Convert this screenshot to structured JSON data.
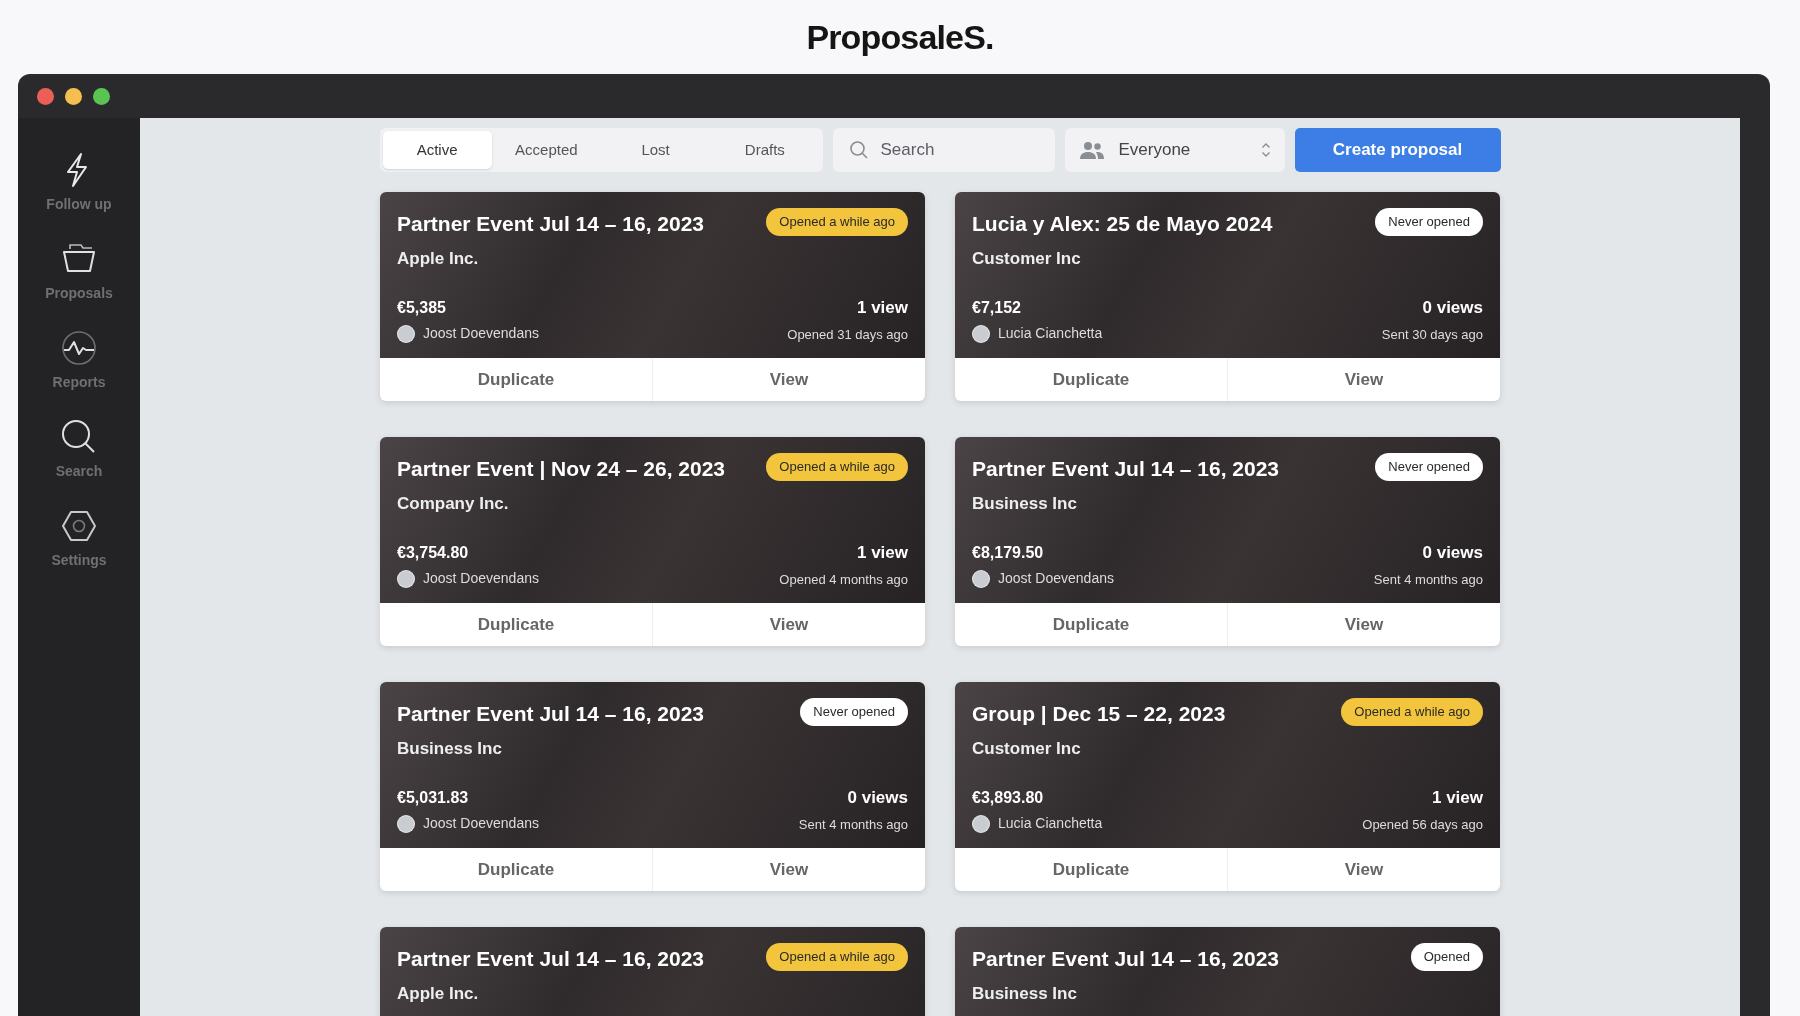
{
  "brand": "ProposaleS.",
  "sidebar": {
    "items": [
      {
        "label": "Follow up",
        "selected": false
      },
      {
        "label": "Proposals",
        "selected": false
      },
      {
        "label": "Reports",
        "selected": false
      },
      {
        "label": "Search",
        "selected": false
      },
      {
        "label": "Settings",
        "selected": false
      }
    ]
  },
  "tabs": [
    {
      "label": "Active",
      "selected": true
    },
    {
      "label": "Accepted",
      "selected": false
    },
    {
      "label": "Lost",
      "selected": false
    },
    {
      "label": "Drafts",
      "selected": false
    }
  ],
  "search": {
    "placeholder": "Search"
  },
  "owner_filter": {
    "value": "Everyone"
  },
  "create_button": "Create proposal",
  "cards": [
    {
      "title": "Partner Event Jul 14 – 16, 2023",
      "client": "Apple Inc.",
      "amount": "€5,385",
      "owner": "Joost Doevendans",
      "views": "1 view",
      "activity": "Opened 31 days ago",
      "badge": {
        "text": "Opened a while ago",
        "kind": "warning"
      },
      "actions": [
        "Duplicate",
        "View"
      ]
    },
    {
      "title": "Lucia y Alex: 25 de Mayo 2024",
      "client": "Customer Inc",
      "amount": "€7,152",
      "owner": "Lucia Cianchetta",
      "views": "0 views",
      "activity": "Sent 30 days ago",
      "badge": {
        "text": "Never opened",
        "kind": "neutral"
      },
      "actions": [
        "Duplicate",
        "View"
      ]
    },
    {
      "title": "Partner Event | Nov 24 – 26, 2023",
      "client": "Company Inc.",
      "amount": "€3,754.80",
      "owner": "Joost Doevendans",
      "views": "1 view",
      "activity": "Opened 4 months ago",
      "badge": {
        "text": "Opened a while ago",
        "kind": "warning"
      },
      "actions": [
        "Duplicate",
        "View"
      ]
    },
    {
      "title": "Partner Event Jul 14 – 16, 2023",
      "client": "Business Inc",
      "amount": "€8,179.50",
      "owner": "Joost Doevendans",
      "views": "0 views",
      "activity": "Sent 4 months ago",
      "badge": {
        "text": "Never opened",
        "kind": "neutral"
      },
      "actions": [
        "Duplicate",
        "View"
      ]
    },
    {
      "title": "Partner Event Jul 14 – 16, 2023",
      "client": "Business Inc",
      "amount": "€5,031.83",
      "owner": "Joost Doevendans",
      "views": "0 views",
      "activity": "Sent 4 months ago",
      "badge": {
        "text": "Never opened",
        "kind": "neutral"
      },
      "actions": [
        "Duplicate",
        "View"
      ]
    },
    {
      "title": "Group | Dec 15 – 22, 2023",
      "client": "Customer Inc",
      "amount": "€3,893.80",
      "owner": "Lucia Cianchetta",
      "views": "1 view",
      "activity": "Opened 56 days ago",
      "badge": {
        "text": "Opened a while ago",
        "kind": "warning"
      },
      "actions": [
        "Duplicate",
        "View"
      ]
    },
    {
      "title": "Partner Event Jul 14 – 16, 2023",
      "client": "Apple Inc.",
      "badge": {
        "text": "Opened a while ago",
        "kind": "warning"
      }
    },
    {
      "title": "Partner Event Jul 14 – 16, 2023",
      "client": "Business Inc",
      "badge": {
        "text": "Opened",
        "kind": "neutral"
      }
    }
  ]
}
